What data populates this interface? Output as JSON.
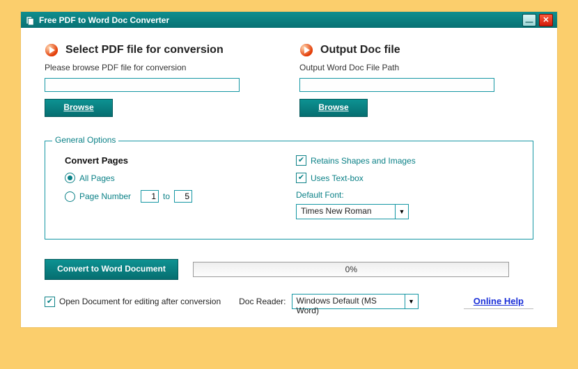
{
  "window": {
    "title": "Free PDF to Word Doc Converter"
  },
  "left": {
    "heading": "Select PDF file for conversion",
    "subtext": "Please browse PDF file for conversion",
    "value": "",
    "browse": "Browse"
  },
  "right": {
    "heading": "Output Doc file",
    "subtext": "Output Word Doc File Path",
    "value": "",
    "browse": "Browse"
  },
  "options": {
    "legend": "General Options",
    "convert_pages_title": "Convert Pages",
    "all_pages": "All Pages",
    "page_number": "Page Number",
    "page_from": "1",
    "to_label": "to",
    "page_to": "5",
    "retains": "Retains Shapes and Images",
    "uses_textbox": "Uses Text-box",
    "default_font_label": "Default Font:",
    "default_font_value": "Times New Roman"
  },
  "bottom": {
    "convert": "Convert to Word Document",
    "progress": "0%",
    "open_after": "Open Document for editing after conversion",
    "doc_reader_label": "Doc Reader:",
    "doc_reader_value": "Windows Default (MS Word)",
    "help": "Online Help"
  }
}
